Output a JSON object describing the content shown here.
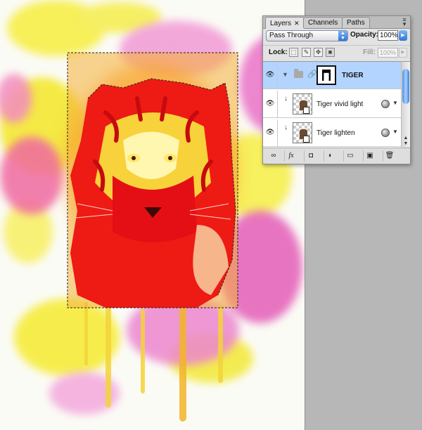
{
  "panel": {
    "tabs": [
      {
        "label": "Layers",
        "active": true
      },
      {
        "label": "Channels",
        "active": false
      },
      {
        "label": "Paths",
        "active": false
      }
    ],
    "tab_close_glyph": "✕",
    "blend_mode": "Pass Through",
    "opacity_label": "Opacity:",
    "opacity_value": "100%",
    "lock_label": "Lock:",
    "fill_label": "Fill:",
    "fill_value": "100%",
    "layers": [
      {
        "name": "TIGER",
        "type": "group",
        "visible": true,
        "selected": true,
        "has_mask": true
      },
      {
        "name": "Tiger vivid light",
        "type": "smart-object",
        "visible": true,
        "selected": false
      },
      {
        "name": "Tiger lighten",
        "type": "smart-object",
        "visible": true,
        "selected": false
      }
    ],
    "bottom_icons": [
      "link-icon",
      "fx-icon",
      "mask-icon",
      "adjustment-icon",
      "new-group-icon",
      "new-layer-icon",
      "trash-icon"
    ],
    "bottom_labels": [
      "∞",
      "fx",
      "◘",
      "◐",
      "▭",
      "▣",
      "🗑"
    ]
  },
  "colors": {
    "selection_blue": "#b3d4ff",
    "panel_bg": "#e3e3e3",
    "workspace_gray": "#b7b7b7",
    "tiger_red": "#e8101a",
    "tiger_orange": "#ff8a14",
    "splash_yellow": "#f6ee28",
    "splash_magenta": "#e0409e"
  }
}
